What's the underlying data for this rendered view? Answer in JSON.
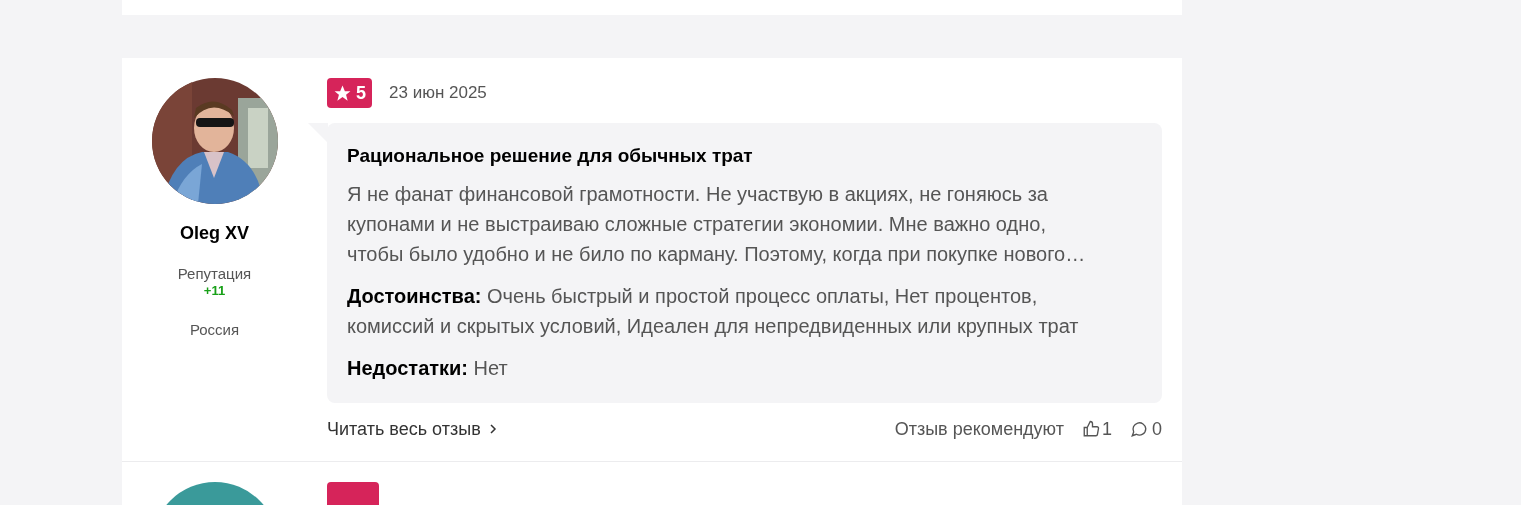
{
  "review": {
    "author": {
      "name": "Oleg XV",
      "reputation_label": "Репутация",
      "reputation": "+11",
      "country": "Россия"
    },
    "rating": "5",
    "date": "23 июн 2025",
    "title": "Рациональное решение для обычных трат",
    "text": "Я не фанат финансовой грамотности. Не участвую в акциях, не гоняюсь за купонами и не выстраиваю сложные стратегии экономии. Мне важно одно, чтобы было удобно и не било по карману. Поэтому, когда при покупке нового…",
    "pros_label": "Достоинства:",
    "pros": "Очень быстрый и простой процесс оплаты, Нет процентов, комиссий и скрытых условий, Идеален для непредвиденных или крупных трат",
    "cons_label": "Недостатки:",
    "cons": "Нет",
    "read_more": "Читать весь отзыв",
    "recommend_label": "Отзыв рекомендуют",
    "likes": "1",
    "comments": "0"
  }
}
